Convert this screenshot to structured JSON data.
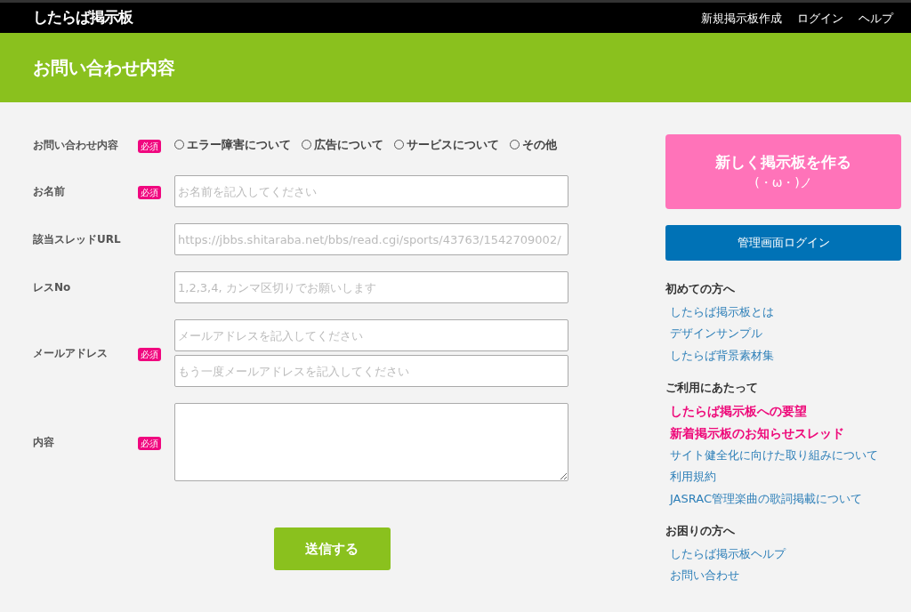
{
  "topbar": {
    "logo": "したらば掲示板",
    "links": [
      "新規掲示板作成",
      "ログイン",
      "ヘルプ"
    ]
  },
  "page_title": "お問い合わせ内容",
  "form": {
    "rows": [
      {
        "kind": "radios",
        "label": "お問い合わせ内容",
        "required": true,
        "required_badge": "必須",
        "options": [
          {
            "label": "エラー障害について",
            "selected": false
          },
          {
            "label": "広告について",
            "selected": false
          },
          {
            "label": "サービスについて",
            "selected": false
          },
          {
            "label": "その他",
            "selected": false
          }
        ]
      },
      {
        "kind": "input",
        "label": "お名前",
        "required": true,
        "required_badge": "必須",
        "placeholders": [
          "お名前を記入してください"
        ]
      },
      {
        "kind": "input",
        "label": "該当スレッドURL",
        "required": false,
        "placeholders": [
          "https://jbbs.shitaraba.net/bbs/read.cgi/sports/43763/1542709002/"
        ]
      },
      {
        "kind": "input",
        "label": "レスNo",
        "required": false,
        "placeholders": [
          "1,2,3,4, カンマ区切りでお願いします"
        ]
      },
      {
        "kind": "input",
        "label": "メールアドレス",
        "required": true,
        "required_badge": "必須",
        "placeholders": [
          "メールアドレスを記入してください",
          "もう一度メールアドレスを記入してください"
        ]
      },
      {
        "kind": "textarea",
        "label": "内容",
        "required": true,
        "required_badge": "必須"
      }
    ],
    "submit": "送信する"
  },
  "sidebar": {
    "create_button": {
      "title": "新しく掲示板を作る",
      "face": "(・ω・)ノ"
    },
    "admin_button": "管理画面ログイン",
    "sections": [
      {
        "heading": "初めての方へ",
        "links": [
          {
            "label": "したらば掲示板とは",
            "kind": "normal"
          },
          {
            "label": "デザインサンプル",
            "kind": "normal"
          },
          {
            "label": "したらば背景素材集",
            "kind": "normal"
          }
        ]
      },
      {
        "heading": "ご利用にあたって",
        "links": [
          {
            "label": "したらば掲示板への要望",
            "kind": "featured"
          },
          {
            "label": "新着掲示板のお知らせスレッド",
            "kind": "featured"
          },
          {
            "label": "サイト健全化に向けた取り組みについて",
            "kind": "normal"
          },
          {
            "label": "利用規約",
            "kind": "normal"
          },
          {
            "label": "JASRAC管理楽曲の歌詞掲載について",
            "kind": "normal"
          }
        ]
      },
      {
        "heading": "お困りの方へ",
        "links": [
          {
            "label": "したらば掲示板ヘルプ",
            "kind": "normal"
          },
          {
            "label": "お問い合わせ",
            "kind": "normal"
          }
        ]
      }
    ]
  }
}
